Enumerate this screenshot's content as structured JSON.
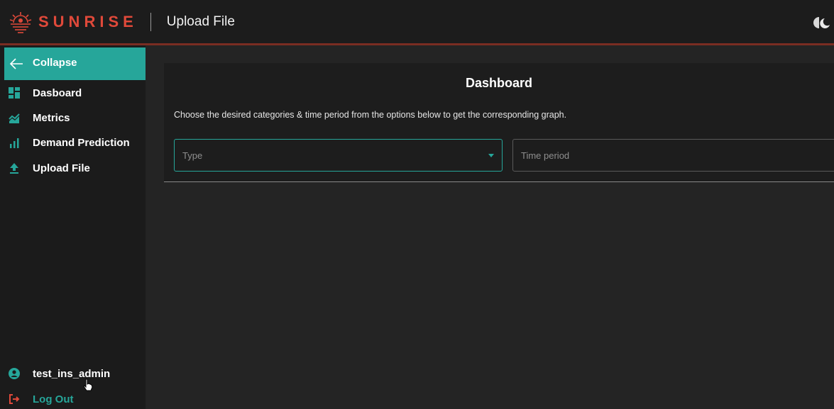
{
  "header": {
    "brand_name": "SUNRISE",
    "page_title": "Upload File"
  },
  "sidebar": {
    "collapse_label": "Collapse",
    "items": [
      {
        "label": "Dasboard",
        "icon": "dashboard-icon"
      },
      {
        "label": "Metrics",
        "icon": "metrics-icon"
      },
      {
        "label": "Demand Prediction",
        "icon": "bar-chart-icon"
      },
      {
        "label": "Upload File",
        "icon": "upload-icon"
      }
    ],
    "user_name": "test_ins_admin",
    "logout_label": "Log Out"
  },
  "main": {
    "card_title": "Dashboard",
    "description": "Choose the desired categories & time period from the options below to get the corresponding graph.",
    "type_select": {
      "placeholder": "Type"
    },
    "period_select": {
      "placeholder": "Time period"
    }
  },
  "colors": {
    "accent": "#26a69a",
    "brand": "#e0493a",
    "background": "#242424",
    "sidebar": "#1b1b1b"
  }
}
